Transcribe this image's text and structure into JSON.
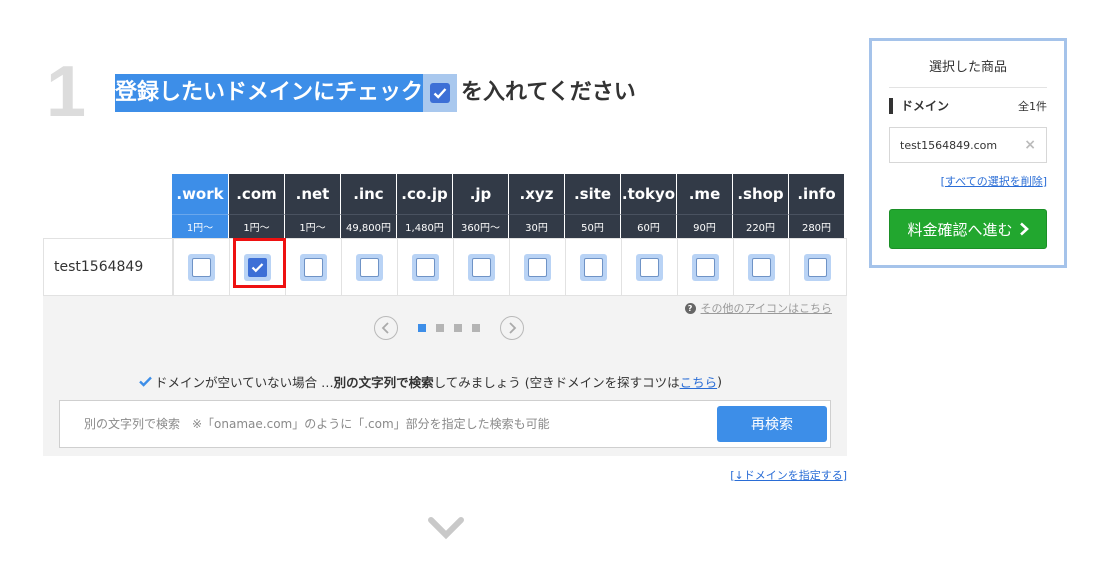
{
  "step": {
    "number": "1"
  },
  "heading": {
    "highlight": "登録したいドメインにチェック",
    "rest": "を入れてください"
  },
  "domain_name": "test1564849",
  "tlds": [
    {
      "name": ".work",
      "price": "1円〜",
      "selected_col": true,
      "checked": false
    },
    {
      "name": ".com",
      "price": "1円〜",
      "selected_col": false,
      "checked": true
    },
    {
      "name": ".net",
      "price": "1円〜",
      "selected_col": false,
      "checked": false
    },
    {
      "name": ".inc",
      "price": "49,800円",
      "selected_col": false,
      "checked": false
    },
    {
      "name": ".co.jp",
      "price": "1,480円",
      "selected_col": false,
      "checked": false
    },
    {
      "name": ".jp",
      "price": "360円〜",
      "selected_col": false,
      "checked": false
    },
    {
      "name": ".xyz",
      "price": "30円",
      "selected_col": false,
      "checked": false
    },
    {
      "name": ".site",
      "price": "50円",
      "selected_col": false,
      "checked": false
    },
    {
      "name": ".tokyo",
      "price": "60円",
      "selected_col": false,
      "checked": false
    },
    {
      "name": ".me",
      "price": "90円",
      "selected_col": false,
      "checked": false
    },
    {
      "name": ".shop",
      "price": "220円",
      "selected_col": false,
      "checked": false
    },
    {
      "name": ".info",
      "price": "280円",
      "selected_col": false,
      "checked": false
    }
  ],
  "other_icons_link": "その他のアイコンはこちら",
  "pager": {
    "pages": 4,
    "current": 1
  },
  "hint": {
    "prefix": "ドメインが空いていない場合 … ",
    "bold": "別の文字列で検索",
    "middle": "してみましょう (空きドメインを探すコツは",
    "link": "こちら",
    "suffix": ")"
  },
  "search": {
    "placeholder": "別の文字列で検索　※「onamae.com」のように「.com」部分を指定した検索も可能",
    "value": "",
    "button": "再検索"
  },
  "specify_link": {
    "open": "[",
    "text": "↓ドメインを指定する",
    "close": "]"
  },
  "cart": {
    "title": "選択した商品",
    "section_label": "ドメイン",
    "count": "全1件",
    "item": "test1564849.com",
    "clear": {
      "open": "[",
      "text": "すべての選択を削除",
      "close": "]"
    },
    "price_button": "料金確認へ進む"
  },
  "colors": {
    "accent": "#3d8ee8",
    "header_dark": "#323a47",
    "cta_green": "#22a72f",
    "highlight_red": "#e11111"
  }
}
